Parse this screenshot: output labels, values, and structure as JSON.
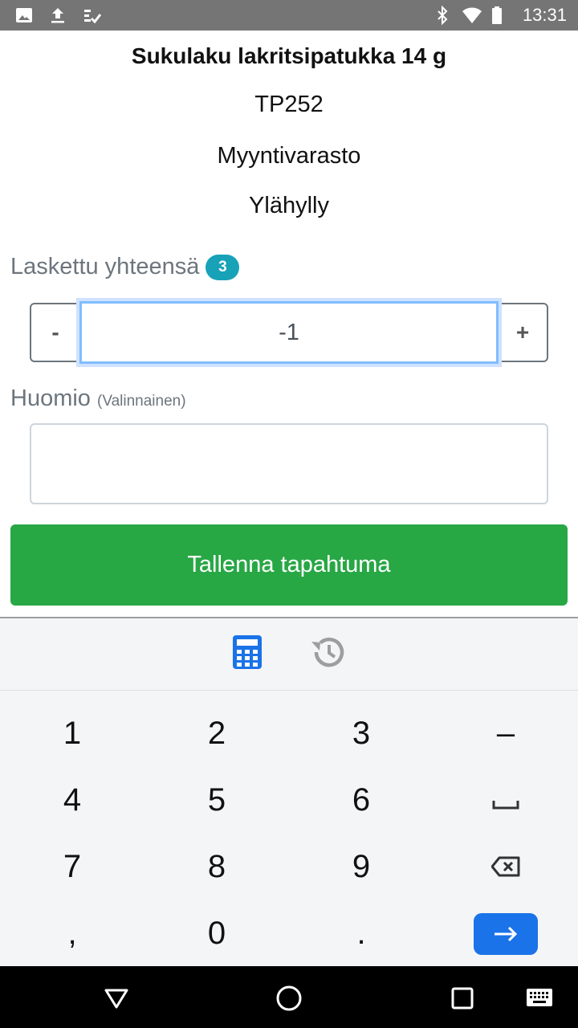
{
  "status_bar": {
    "time": "13:31",
    "left_icons": [
      "image-icon",
      "upload-icon",
      "checklist-icon"
    ],
    "right_icons": [
      "bluetooth-icon",
      "wifi-icon",
      "battery-icon"
    ]
  },
  "product": {
    "title": "Sukulaku lakritsipatukka 14 g",
    "code": "TP252",
    "warehouse": "Myyntivarasto",
    "shelf": "Ylähylly"
  },
  "count": {
    "label": "Laskettu yhteensä",
    "badge": "3",
    "minus_label": "-",
    "plus_label": "+",
    "value": "-1"
  },
  "note": {
    "label": "Huomio",
    "optional_label": "(Valinnainen)",
    "value": ""
  },
  "save_button": {
    "label": "Tallenna tapahtuma"
  },
  "colors": {
    "save": "#28a745",
    "badge": "#17a2b8",
    "focus": "#80bdff",
    "keyboard_accent": "#1a73e8"
  },
  "keyboard": {
    "toolbar_icons": [
      "calculator-icon",
      "history-icon"
    ],
    "keys": [
      "1",
      "2",
      "3",
      "–",
      "4",
      "5",
      "6",
      "␣",
      "7",
      "8",
      "9",
      "⌫",
      ",",
      "0",
      ".",
      "→"
    ]
  },
  "nav_bar": {
    "icons": [
      "back-icon",
      "home-icon",
      "recents-icon",
      "keyboard-switch-icon"
    ]
  }
}
